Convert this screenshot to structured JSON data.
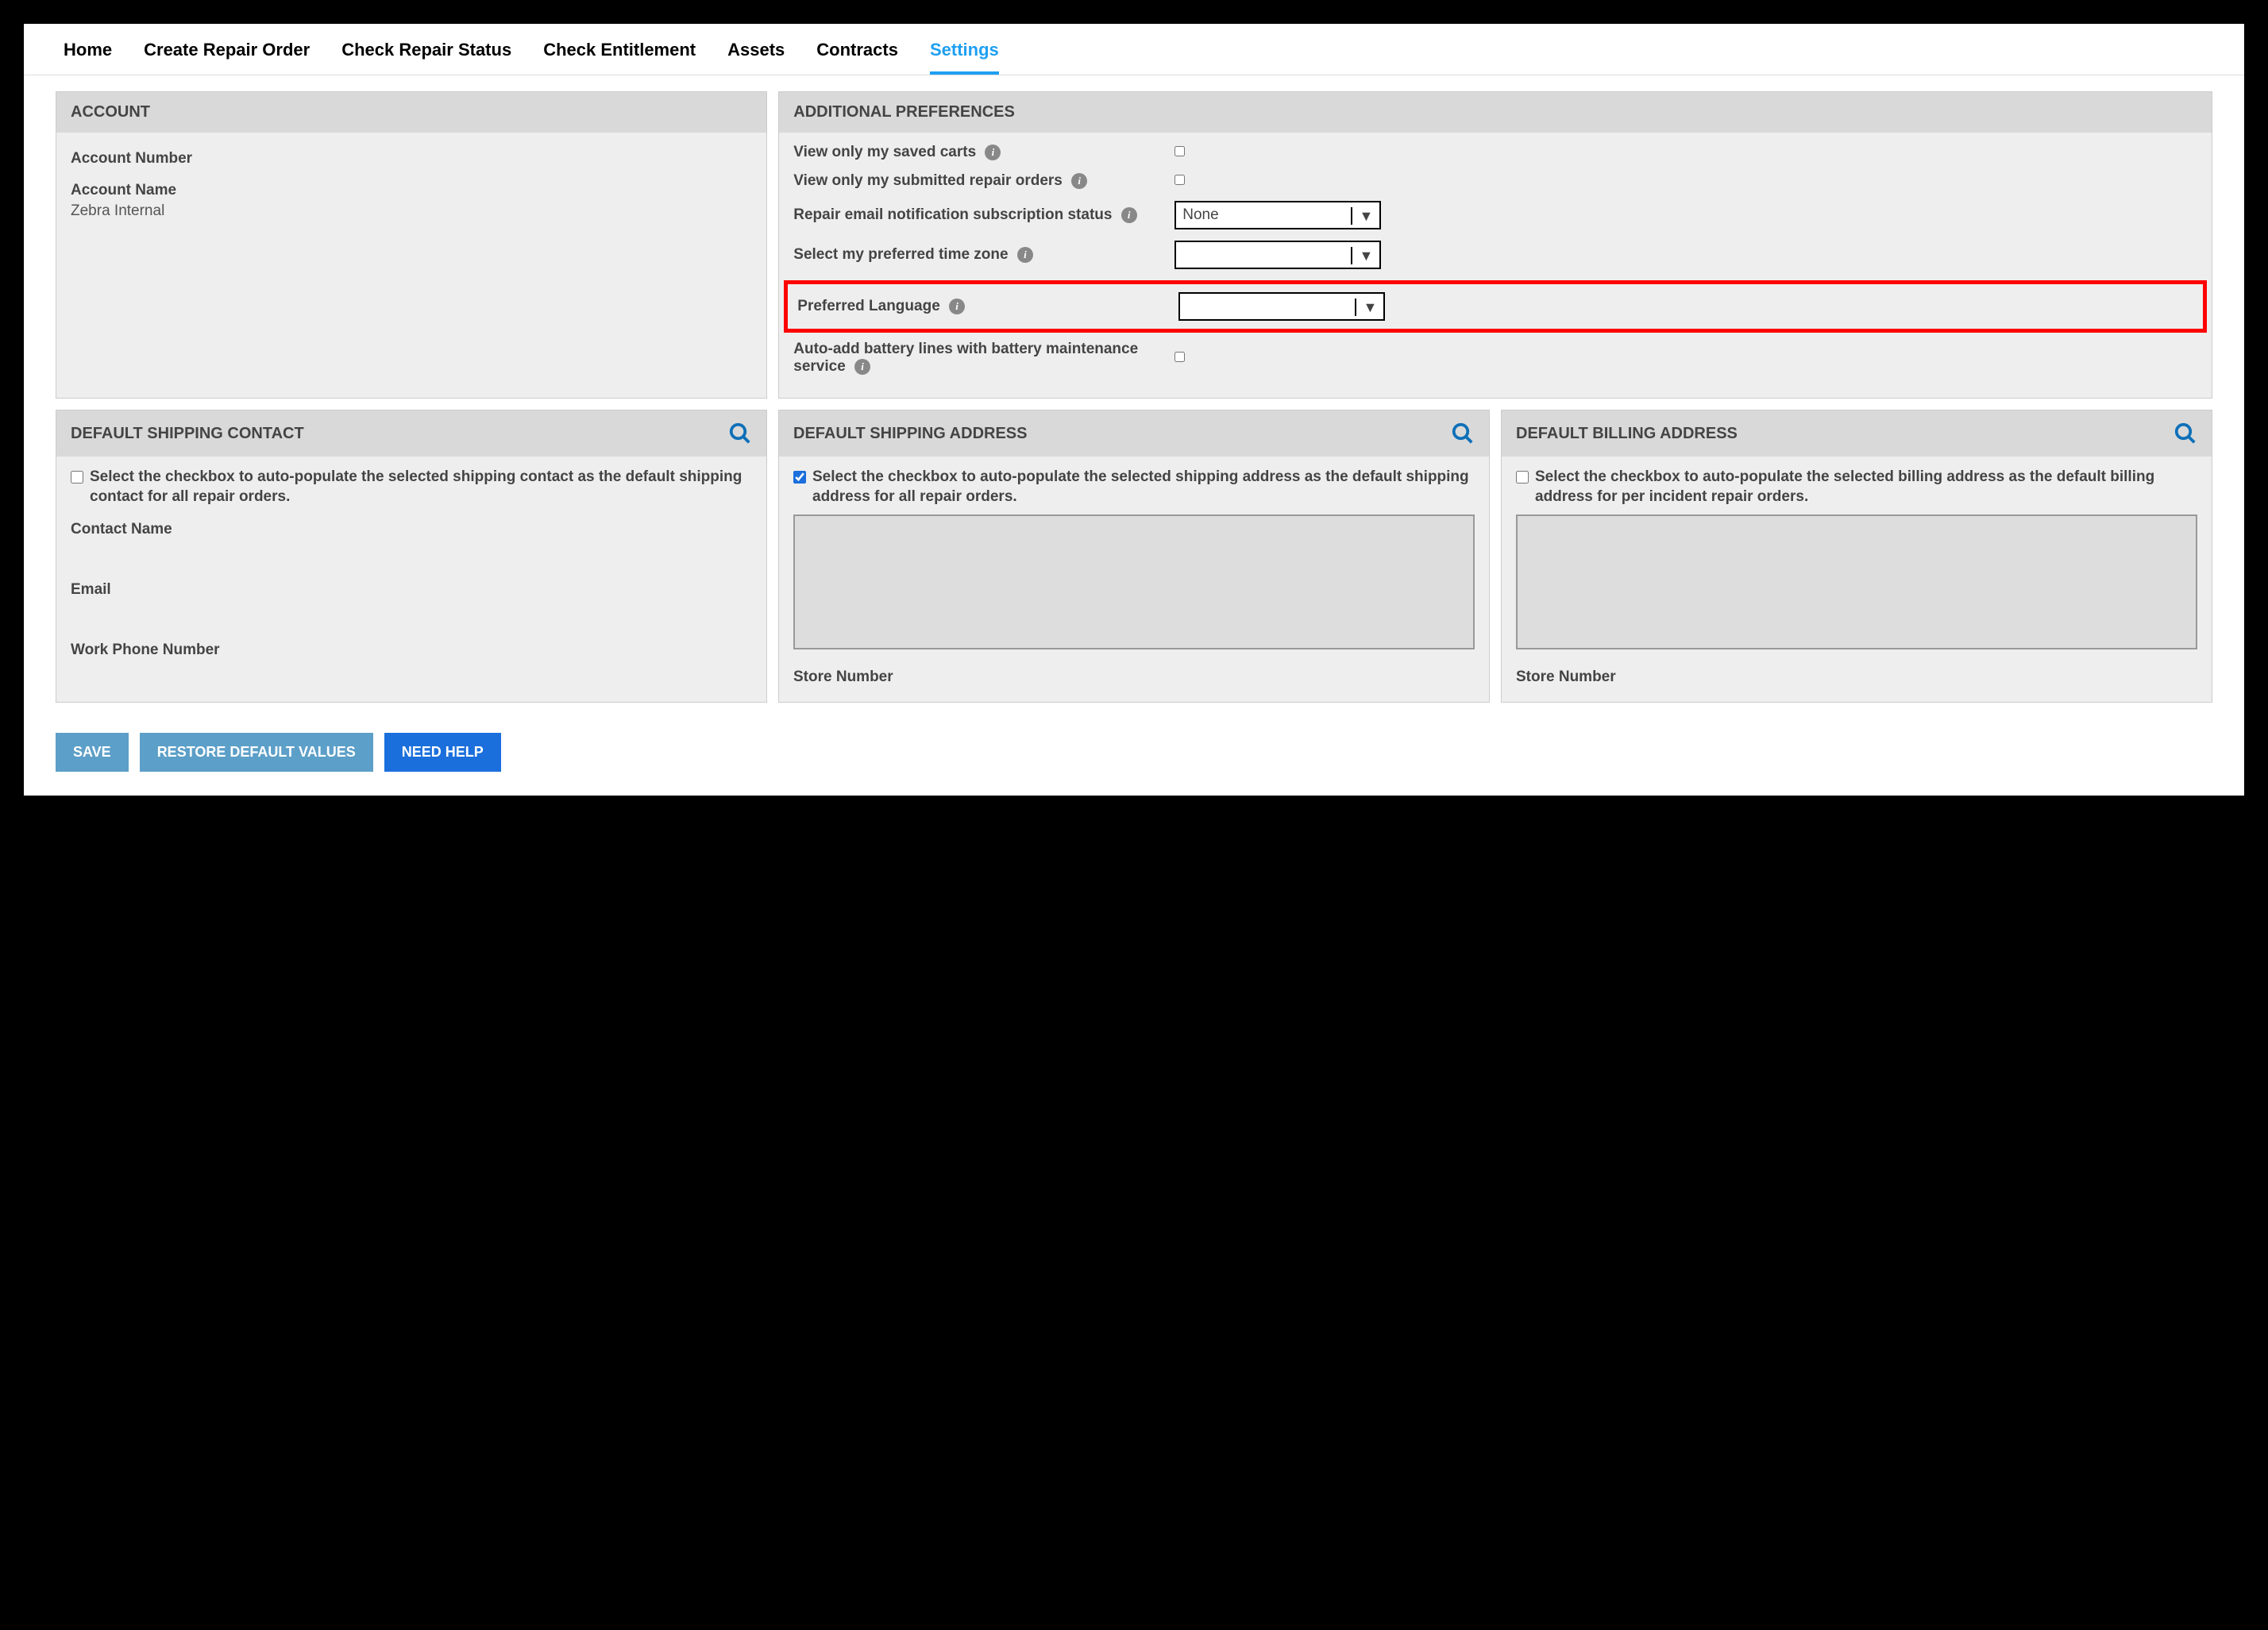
{
  "tabs": [
    "Home",
    "Create Repair Order",
    "Check Repair Status",
    "Check Entitlement",
    "Assets",
    "Contracts",
    "Settings"
  ],
  "activeTab": "Settings",
  "account": {
    "header": "ACCOUNT",
    "numberLabel": "Account Number",
    "numberValue": "",
    "nameLabel": "Account Name",
    "nameValue": "Zebra Internal"
  },
  "prefs": {
    "header": "ADDITIONAL PREFERENCES",
    "rows": {
      "savedCarts": "View only my saved carts",
      "submittedOrders": "View only my submitted repair orders",
      "emailNotif": "Repair email notification subscription status",
      "emailNotifValue": "None",
      "timezone": "Select my preferred time zone",
      "timezoneValue": "",
      "language": "Preferred Language",
      "languageValue": "",
      "autoBattery": "Auto-add battery lines with battery maintenance service"
    }
  },
  "shippingContact": {
    "header": "DEFAULT SHIPPING CONTACT",
    "checkboxText": "Select the checkbox to auto-populate the selected shipping contact as the default shipping contact for all repair orders.",
    "checked": false,
    "contactNameLabel": "Contact Name",
    "emailLabel": "Email",
    "phoneLabel": "Work Phone Number"
  },
  "shippingAddress": {
    "header": "DEFAULT SHIPPING ADDRESS",
    "checkboxText": "Select the checkbox to auto-populate the selected shipping address as the default shipping address for all repair orders.",
    "checked": true,
    "storeLabel": "Store Number"
  },
  "billingAddress": {
    "header": "DEFAULT BILLING ADDRESS",
    "checkboxText": "Select the checkbox to auto-populate the selected billing address as the default billing address for per incident repair orders.",
    "checked": false,
    "storeLabel": "Store Number"
  },
  "buttons": {
    "save": "SAVE",
    "restore": "RESTORE DEFAULT VALUES",
    "help": "NEED HELP"
  }
}
